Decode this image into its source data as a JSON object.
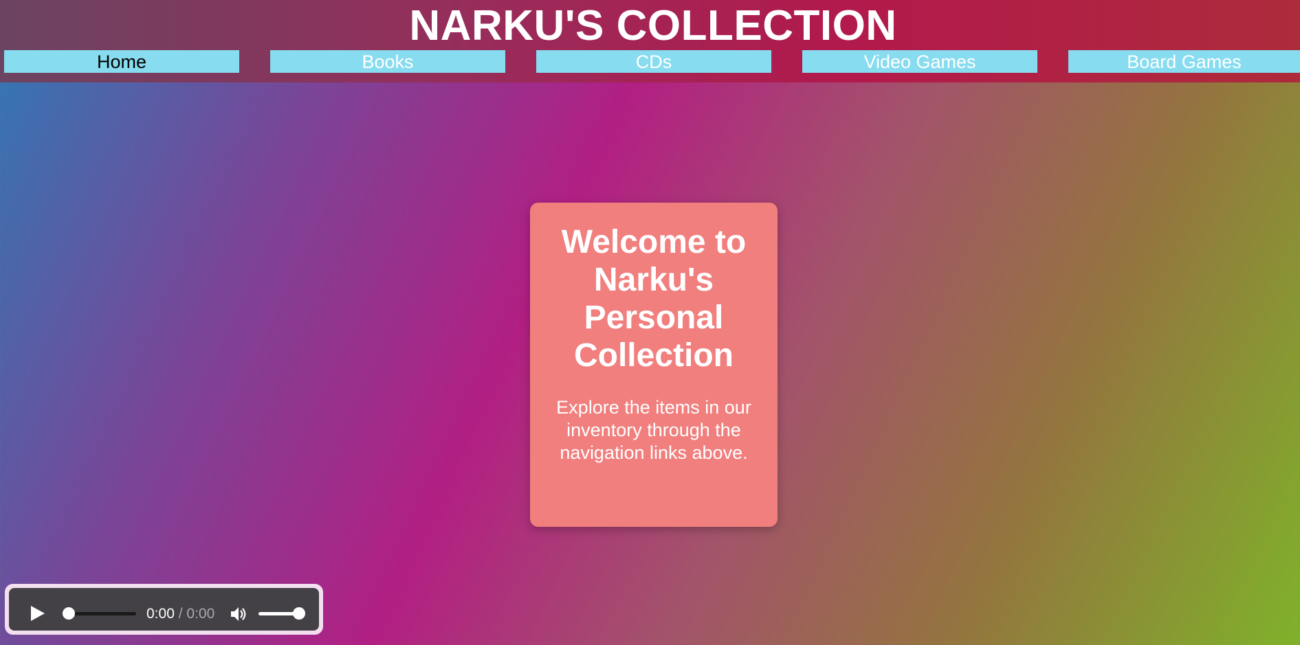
{
  "header": {
    "title": "NARKU'S COLLECTION",
    "nav": [
      {
        "label": "Home",
        "active": true
      },
      {
        "label": "Books",
        "active": false
      },
      {
        "label": "CDs",
        "active": false
      },
      {
        "label": "Video Games",
        "active": false
      },
      {
        "label": "Board Games",
        "active": false
      }
    ]
  },
  "welcome": {
    "title": "Welcome to Narku's Personal Collection",
    "text": "Explore the items in our inventory through the navigation links above."
  },
  "audio_player": {
    "current_time": "0:00",
    "separator": "/",
    "duration": "0:00",
    "progress": 0,
    "volume": 1.0,
    "icons": {
      "play": "play-icon",
      "volume": "speaker-icon"
    }
  },
  "colors": {
    "nav_bg": "#87dcef",
    "card_bg": "#f07f7e",
    "player_bg": "#434145"
  }
}
